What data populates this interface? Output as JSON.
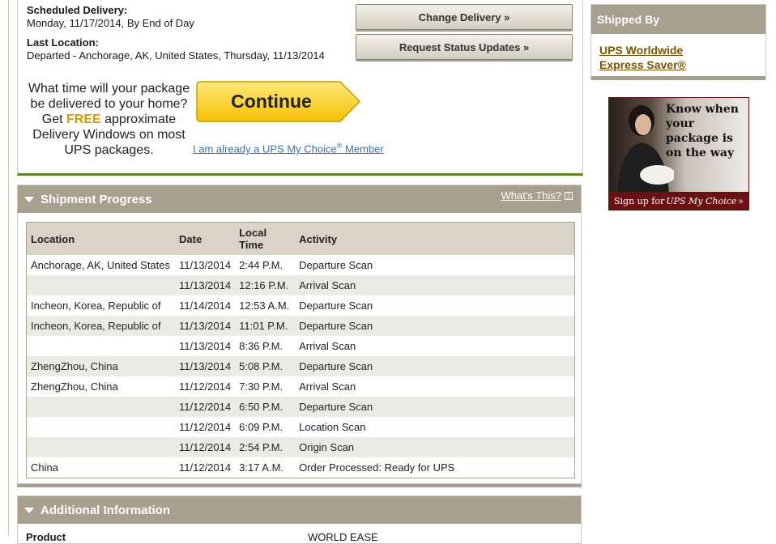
{
  "delivery": {
    "scheduled_label": "Scheduled Delivery:",
    "scheduled_value": "Monday, 11/17/2014, By End of Day",
    "last_location_label": "Last Location:",
    "last_location_value": "Departed - Anchorage, AK, United States, Thursday, 11/13/2014",
    "change_delivery_button": "Change Delivery »",
    "status_updates_button": "Request Status Updates »"
  },
  "promo": {
    "line1": "What time will your package be delivered to your home?",
    "get": "Get",
    "free": "FREE",
    "rest": "approximate Delivery Windows on most UPS packages.",
    "continue_button": "Continue",
    "member_link": "I am already a UPS My Choice",
    "member_link_reg": "®",
    "member_link_end": " Member"
  },
  "shipment_progress": {
    "title": "Shipment Progress",
    "whats_this": "What's This?",
    "columns": [
      "Location",
      "Date",
      "Local Time",
      "Activity"
    ],
    "rows": [
      [
        "Anchorage, AK, United States",
        "11/13/2014",
        "2:44 P.M.",
        "Departure Scan"
      ],
      [
        "",
        "11/13/2014",
        "12:16 P.M.",
        "Arrival Scan"
      ],
      [
        "Incheon, Korea, Republic of",
        "11/14/2014",
        "12:53 A.M.",
        "Departure Scan"
      ],
      [
        "Incheon, Korea, Republic of",
        "11/13/2014",
        "11:01 P.M.",
        "Departure Scan"
      ],
      [
        "",
        "11/13/2014",
        "8:36 P.M.",
        "Arrival Scan"
      ],
      [
        "ZhengZhou, China",
        "11/13/2014",
        "5:08 P.M.",
        "Departure Scan"
      ],
      [
        "ZhengZhou, China",
        "11/12/2014",
        "7:30 P.M.",
        "Arrival Scan"
      ],
      [
        "",
        "11/12/2014",
        "6:50 P.M.",
        "Departure Scan"
      ],
      [
        "",
        "11/12/2014",
        "6:09 P.M.",
        "Location Scan"
      ],
      [
        "",
        "11/12/2014",
        "2:54 P.M.",
        "Origin Scan"
      ],
      [
        "China",
        "11/12/2014",
        "3:17 A.M.",
        "Order Processed: Ready for UPS"
      ]
    ]
  },
  "additional_info": {
    "title": "Additional Information",
    "partial_label": "Product",
    "partial_value": "WORLD EASE"
  },
  "shipped_by": {
    "title": "Shipped By",
    "service_line1": "UPS Worldwide",
    "service_line2": "Express Saver®"
  },
  "ad": {
    "headline": "Know when your package is on the way",
    "cta_prefix": "Sign up for",
    "cta_brand": "UPS My Choice",
    "cta_suffix": "»"
  },
  "colors": {
    "section_header": "#a8a08e",
    "table_header": "#d9d4c7",
    "green_rule": "#5c8a1e",
    "link_blue": "#3d6fb6",
    "free_gold": "#d69a00",
    "ad_maroon": "#6b1111"
  }
}
